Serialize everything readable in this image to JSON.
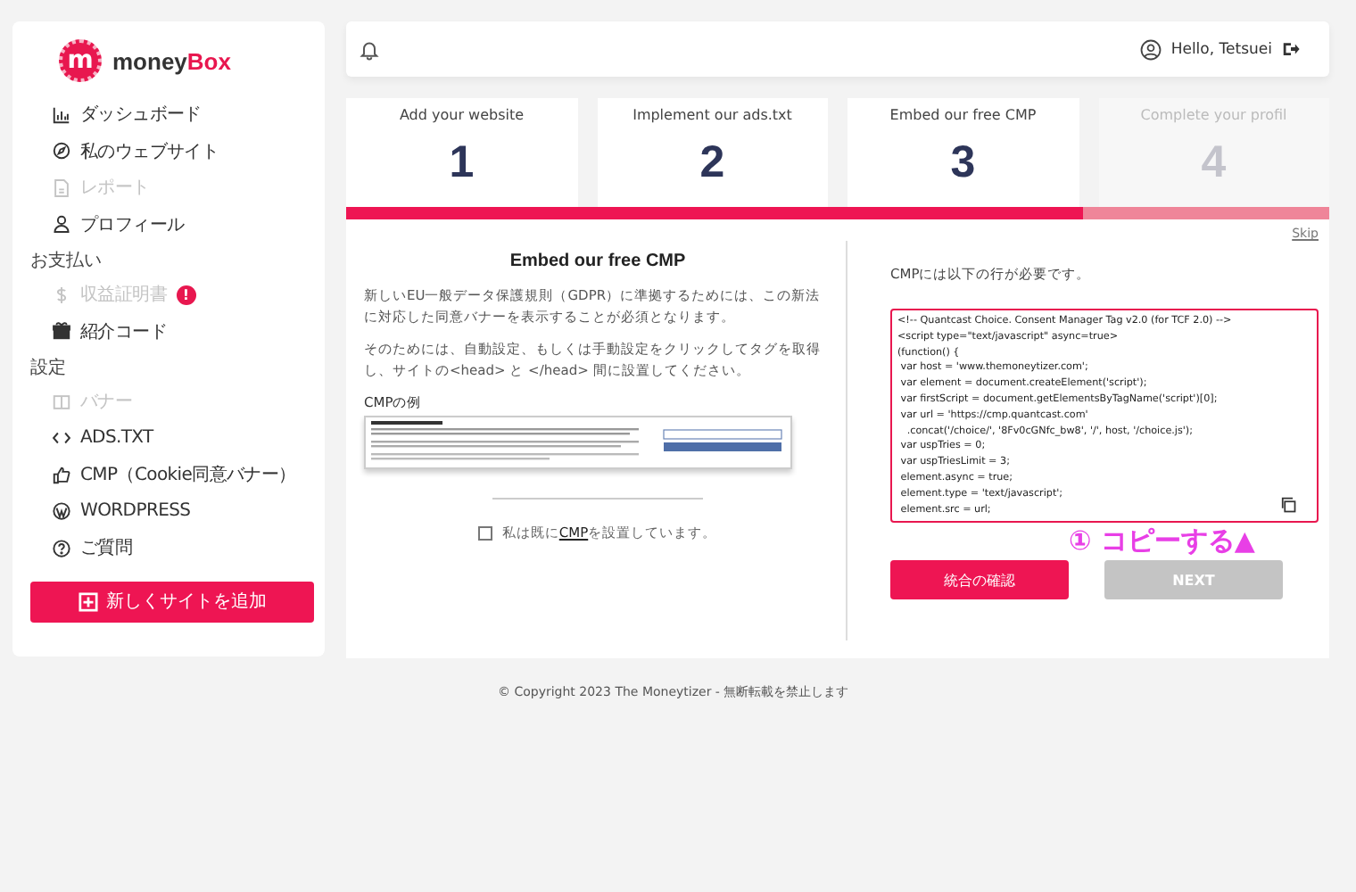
{
  "sidebar": {
    "logo": {
      "mark": "m",
      "text_main": "money",
      "text_accent": "Box"
    },
    "groups": [
      {
        "items": [
          {
            "kind": "chart",
            "label": "ダッシュボード",
            "disabled": false
          },
          {
            "kind": "compass",
            "label": "私のウェブサイト",
            "disabled": false
          },
          {
            "kind": "doc",
            "label": "レポート",
            "disabled": true
          },
          {
            "kind": "user",
            "label": "プロフィール",
            "disabled": false
          }
        ]
      },
      {
        "heading": "お支払い",
        "items": [
          {
            "kind": "dollar",
            "label": "収益証明書",
            "disabled": true,
            "badge": "!"
          },
          {
            "kind": "gift",
            "label": "紹介コード",
            "disabled": false
          }
        ]
      },
      {
        "heading": "設定",
        "items": [
          {
            "kind": "banner",
            "label": "バナー",
            "disabled": true
          },
          {
            "kind": "code",
            "label": "ADS.TXT",
            "disabled": false
          },
          {
            "kind": "thumb",
            "label": "CMP（Cookie同意バナー）",
            "disabled": false
          },
          {
            "kind": "wp",
            "label": "WORDPRESS",
            "disabled": false
          },
          {
            "kind": "help",
            "label": "ご質問",
            "disabled": false
          }
        ]
      }
    ],
    "add_button": "新しくサイトを追加"
  },
  "topbar": {
    "greeting": "Hello, Tetsuei"
  },
  "steps": [
    {
      "label": "Add your website",
      "number": "1",
      "done": true
    },
    {
      "label": "Implement our ads.txt",
      "number": "2",
      "done": true
    },
    {
      "label": "Embed our free CMP",
      "number": "3",
      "done": true
    },
    {
      "label": "Complete your profil",
      "number": "4",
      "done": false
    }
  ],
  "progress": {
    "level": 0.75
  },
  "skip": "Skip",
  "left": {
    "title": "Embed our free CMP",
    "paragraphs": [
      "新しいEU一般データ保護規則（GDPR）に準拠するためには、この新法に対応した同意バナーを表示することが必須となります。",
      "そのためには、自動設定、もしくは手動設定をクリックしてタグを取得し、サイトの<head> と </head> 間に設置してください。"
    ],
    "example_label": "CMPの例",
    "checkbox": {
      "checked": false,
      "before": "私は既に",
      "link": "CMP",
      "after": "を設置しています。"
    }
  },
  "right": {
    "intro": "CMPには以下の行が必要です。",
    "code_lines": [
      "<!-- Quantcast Choice. Consent Manager Tag v2.0 (for TCF 2.0) -->",
      "<script type=\"text/javascript\" async=true>",
      "(function() {",
      " var host = 'www.themoneytizer.com';",
      " var element = document.createElement('script');",
      " var firstScript = document.getElementsByTagName('script')[0];",
      " var url = 'https://cmp.quantcast.com'",
      "   .concat('/choice/', '8Fv0cGNfc_bw8', '/', host, '/choice.js');",
      " var uspTries = 0;",
      " var uspTriesLimit = 3;",
      " element.async = true;",
      " element.type = 'text/javascript';",
      " element.src = url;"
    ],
    "annotation": "① コピーする▲",
    "confirm_button": "統合の確認",
    "next_button": {
      "label": "NEXT",
      "disabled": true
    }
  },
  "footer": "© Copyright 2023 The Moneytizer - 無断転載を禁止します"
}
